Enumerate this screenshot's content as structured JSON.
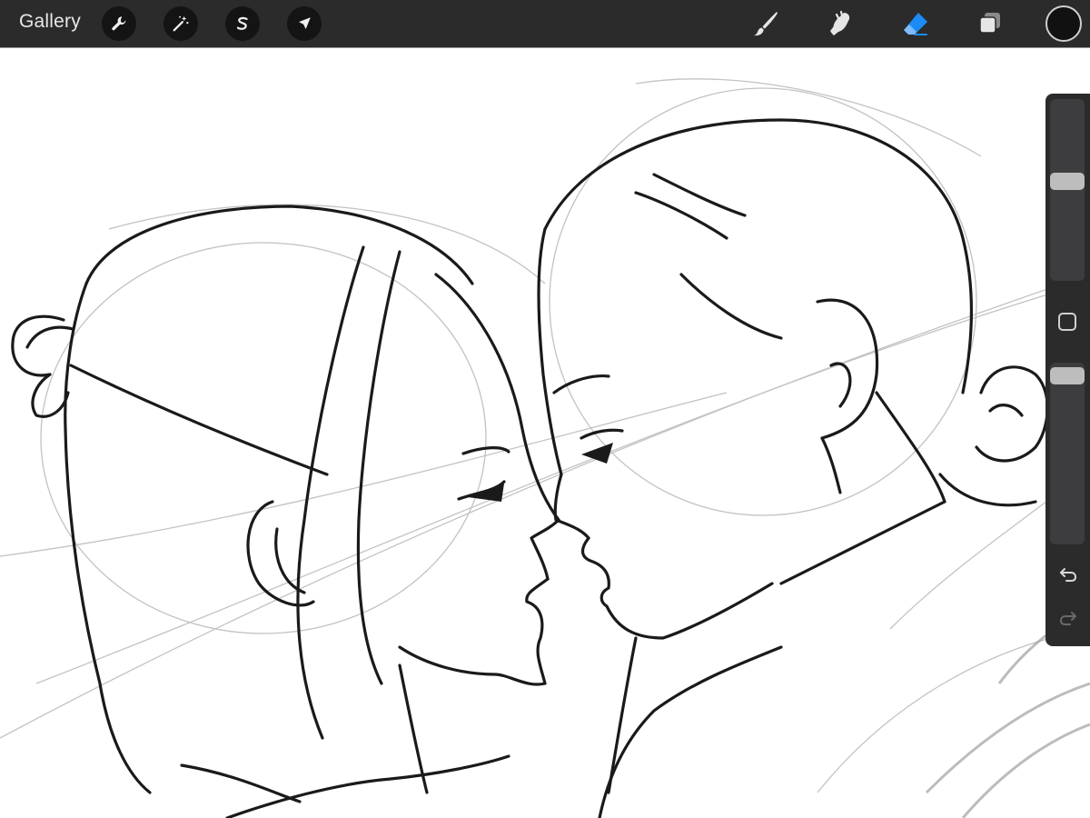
{
  "toolbar": {
    "gallery_label": "Gallery",
    "left_tools": [
      "wrench-icon",
      "magic-wand-icon",
      "selection-s-icon",
      "transform-arrow-icon"
    ],
    "right_tools": [
      "brush-icon",
      "smudge-icon",
      "eraser-icon",
      "layers-icon"
    ],
    "active_tool": "eraser",
    "accent_color": "#1b8cf6",
    "current_color": "#111111"
  },
  "sidebar": {
    "brush_size_level": 0.55,
    "opacity_level": 0.97,
    "buttons": [
      "modify-square-icon",
      "undo-icon",
      "redo-icon"
    ]
  }
}
